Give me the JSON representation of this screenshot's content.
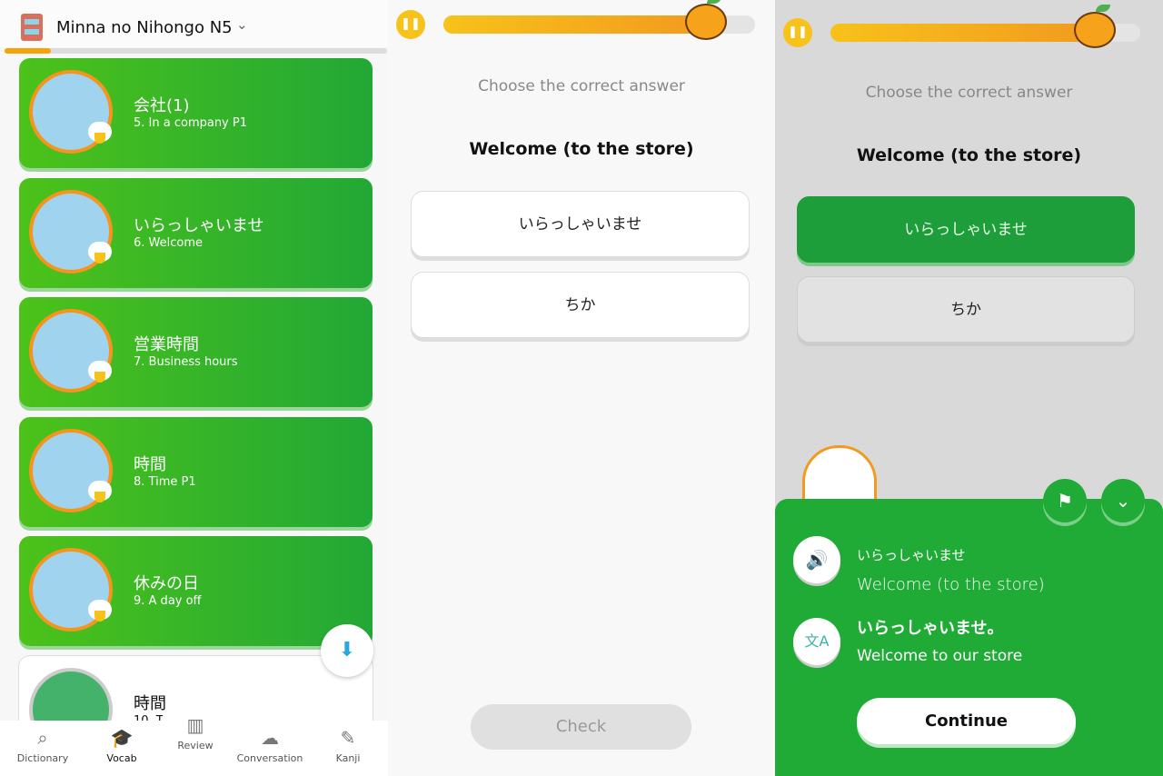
{
  "vocab_screen": {
    "course_title": "Minna no Nihongo N5",
    "course_progress_percent": 5,
    "lessons": [
      {
        "title": "会社(1)",
        "subtitle": "5. In a company P1",
        "completed": true
      },
      {
        "title": "いらっしゃいませ",
        "subtitle": "6. Welcome",
        "completed": true
      },
      {
        "title": "営業時間",
        "subtitle": "7. Business hours",
        "completed": true
      },
      {
        "title": "時間",
        "subtitle": "8. Time P1",
        "completed": true
      },
      {
        "title": "休みの日",
        "subtitle": "9. A day off",
        "completed": true
      },
      {
        "title": "時間",
        "subtitle": "10. T",
        "completed": false
      }
    ],
    "nav": [
      {
        "label": "Dictionary",
        "icon": "magnifier-icon"
      },
      {
        "label": "Vocab",
        "icon": "graduation-cap-icon",
        "active": true
      },
      {
        "label": "Review",
        "icon": "bar-chart-icon"
      },
      {
        "label": "Conversation",
        "icon": "chat-bubbles-icon"
      },
      {
        "label": "Kanji",
        "icon": "note-pencil-icon"
      }
    ]
  },
  "quiz": {
    "instruction": "Choose the correct answer",
    "prompt": "Welcome (to the store)",
    "options": [
      "いらっしゃいませ",
      "ちか"
    ],
    "check_label": "Check",
    "progress_percent": 86
  },
  "result": {
    "instruction": "Choose the correct answer",
    "prompt": "Welcome (to the store)",
    "options": [
      "いらっしゃいませ",
      "ちか"
    ],
    "selected_index": 0,
    "progress_percent": 86,
    "word": "いらっしゃいませ",
    "meaning": "Welcome (to the store)",
    "example": "いらっしゃいませ。",
    "example_translation": "Welcome to our store",
    "continue_label": "Continue",
    "colors": {
      "correct": "#1fab35",
      "accent": "#f7c21a"
    }
  }
}
